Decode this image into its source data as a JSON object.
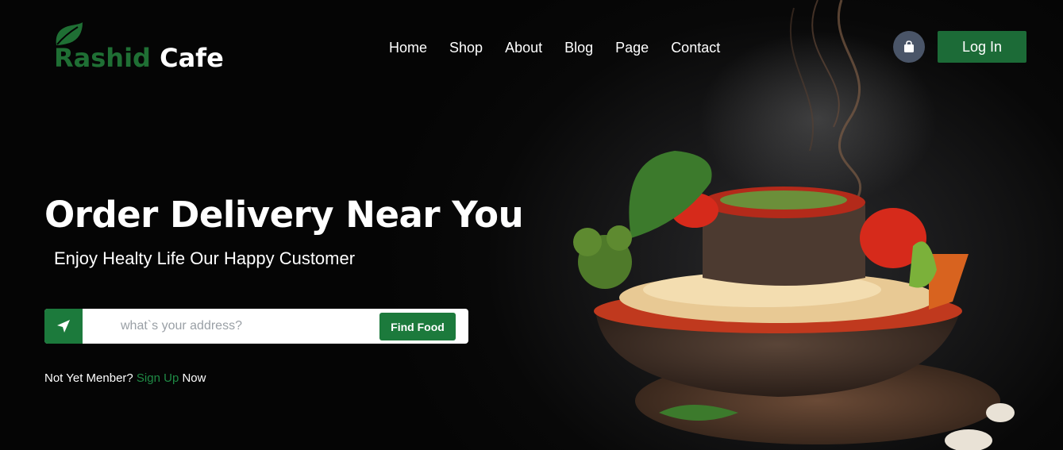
{
  "brand": {
    "name_part1": "Rashid",
    "name_part2": "Cafe"
  },
  "nav": {
    "items": [
      "Home",
      "Shop",
      "About",
      "Blog",
      "Page",
      "Contact"
    ]
  },
  "header": {
    "cart_icon": "shopping-bag-icon",
    "login_label": "Log In"
  },
  "hero": {
    "title": "Order Delivery Near You",
    "subtitle": "Enjoy Healty Life Our Happy Customer"
  },
  "search": {
    "icon": "location-arrow-icon",
    "placeholder": "what`s your address?",
    "value": "",
    "button_label": "Find Food"
  },
  "signup": {
    "prefix": "Not Yet Menber?",
    "link": "Sign Up",
    "suffix": "Now"
  },
  "colors": {
    "brand_green": "#1c7a3c",
    "cart_bg": "#4a5568",
    "background": "#050505"
  }
}
